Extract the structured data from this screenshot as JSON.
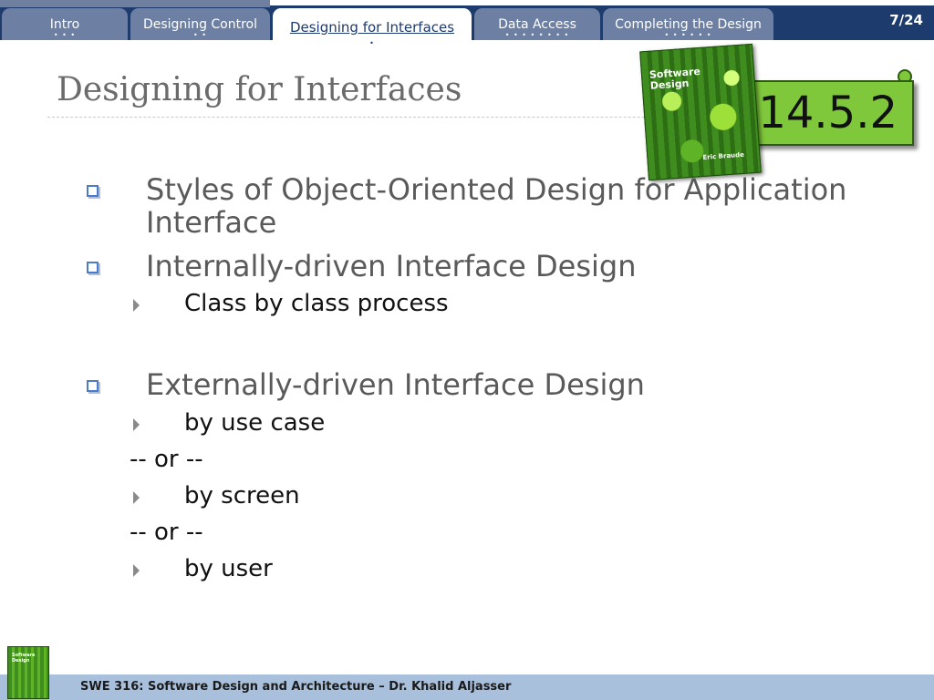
{
  "nav": {
    "tabs": [
      {
        "label": "Intro",
        "dots": "• • •"
      },
      {
        "label": "Designing Control",
        "dots": "• •"
      },
      {
        "label": "Designing for Interfaces",
        "dots": "•"
      },
      {
        "label": "Data Access",
        "dots": "• • • • • • • •"
      },
      {
        "label": "Completing the Design",
        "dots": "• • • • • •"
      }
    ],
    "active_index": 2,
    "page_counter": "7/24"
  },
  "slide": {
    "title": "Designing for Interfaces",
    "section_badge": "14.5.2",
    "book": {
      "title": "Software Design",
      "author": "Eric Braude"
    },
    "bullets": [
      "Styles of Object-Oriented Design for Application Interface",
      "Internally-driven Interface Design",
      "Class by class process",
      "Externally-driven Interface Design",
      "by use case",
      "-- or --",
      "by screen",
      "-- or --",
      "by user"
    ]
  },
  "footer": {
    "text": "SWE 316: Software Design and Architecture – Dr. Khalid Aljasser",
    "thumb_title": "Software Design"
  },
  "colors": {
    "nav_background": "#1e3b6d",
    "tab_inactive": "#6d80a3",
    "badge_green": "#7fc73b",
    "footer_background": "#a8c0dc",
    "bullet_square": "#4d7bc7"
  }
}
